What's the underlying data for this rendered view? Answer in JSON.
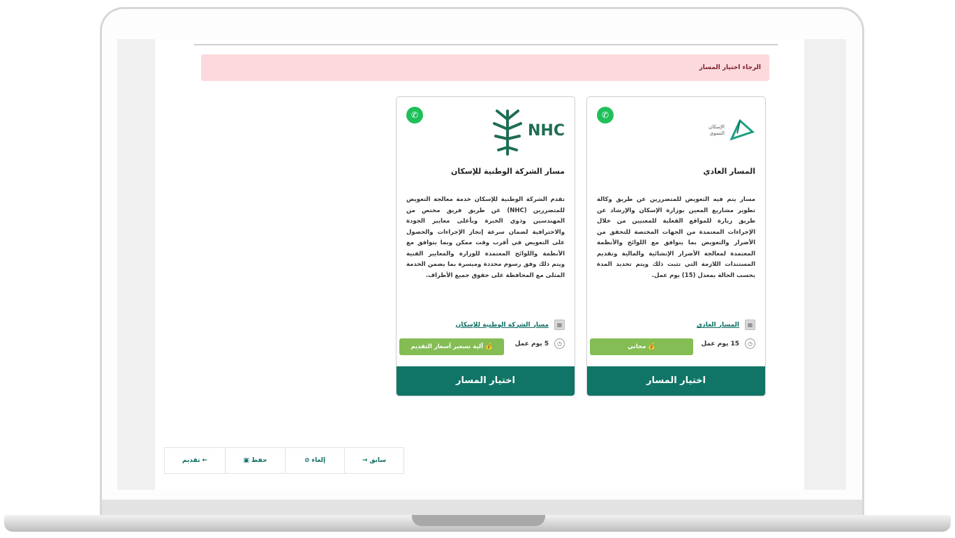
{
  "alert": {
    "text": "الرجاء اختيار المسار"
  },
  "cards": [
    {
      "logo_caption": "الإسكان التنموي",
      "title": "المسار العادي",
      "description": "مسار يتم فيه التعويض للمتضررين عن طريق وكالة تطوير مشاريع المعين بوزارة الإسكان والإرشاد عن طريق زيارة للمواقع الفعلية للمعنيين من خلال الإجراءات المعتمدة من الجهات المختصة للتحقق من الأضرار والتعويض بما يتوافق مع اللوائح والأنظمة المعتمدة لمعالجة الأضرار الإنشائية والمالية وتقديم المستندات اللازمة التي تثبت ذلك ويتم تحديد المدة بحسب الحالة بمعدل (15) يوم عمل.",
      "link": "المسار العادي",
      "duration": "15 يوم عمل",
      "badge": "مجاني",
      "select_label": "اختيار المسار"
    },
    {
      "logo_text": "NHC",
      "title": "مسار الشركة الوطنية للإسكان",
      "description": "تقدم الشركة الوطنية للإسكان خدمة معالجة التعويض للمتضررين (NHC) عن طريق فريق مختص من المهندسين وذوي الخبرة وبأعلى معايير الجودة والاحترافية لضمان سرعة إنجاز الإجراءات والحصول على التعويض في أقرب وقت ممكن وبما يتوافق مع الأنظمة واللوائح المعتمدة للوزارة والمعايير الفنية ويتم ذلك وفق رسوم محددة وميسرة بما يضمن الخدمة المثلى مع المحافظة على حقوق جميع الأطراف.",
      "link": "مسار الشركة الوطنية للإسكان",
      "duration": "5 يوم عمل",
      "badge": "آلية تسعير أسعار التقديم",
      "select_label": "اختيار المسار"
    }
  ],
  "footer": {
    "prev": "سابق",
    "cancel": "إلغاء",
    "save": "حفظ",
    "submit": "تقديم"
  },
  "colors": {
    "primary": "#107566",
    "badge": "#83bd54",
    "alert_bg": "#fbd9dc",
    "whatsapp": "#1fc05a"
  }
}
